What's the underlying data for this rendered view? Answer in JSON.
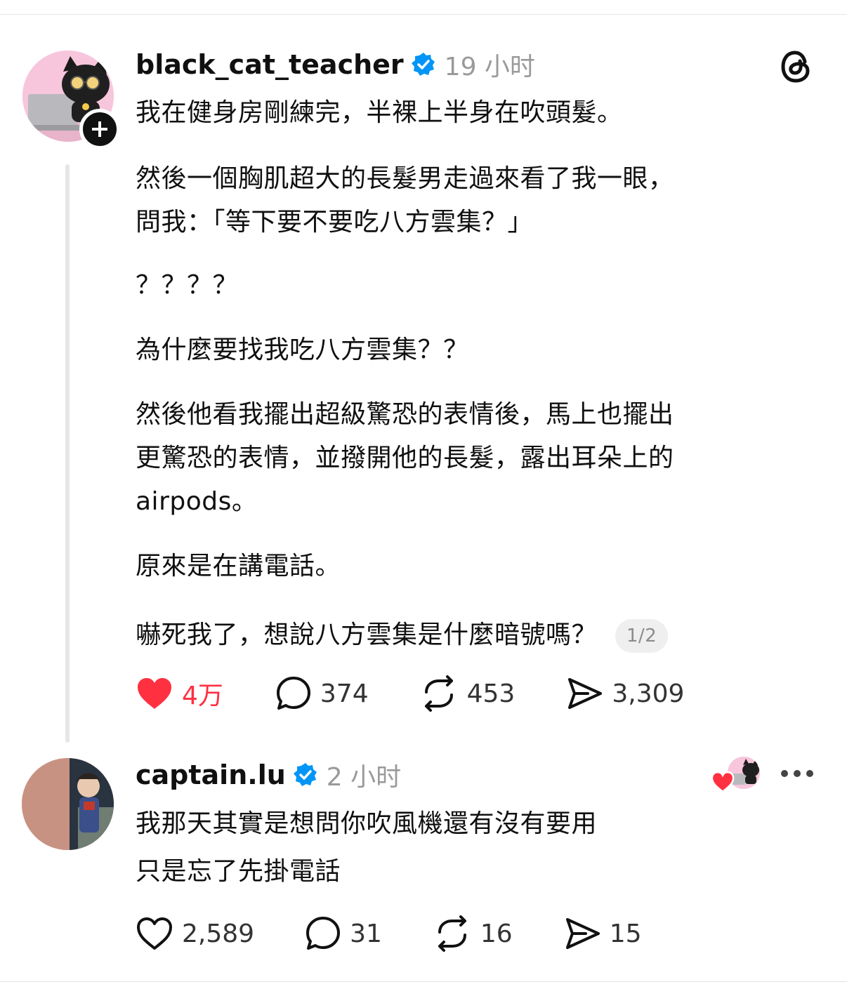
{
  "post": {
    "username": "black_cat_teacher",
    "time": "19 小时",
    "paragraphs": [
      "我在健身房剛練完，半裸上半身在吹頭髮。",
      "然後一個胸肌超大的長髮男走過來看了我一眼，\n問我：「等下要不要吃八方雲集？」",
      "？？？？",
      "為什麼要找我吃八方雲集？？",
      "然後他看我擺出超級驚恐的表情後，馬上也擺出\n更驚恐的表情，並撥開他的長髮，露出耳朵上的\nairpods。",
      "原來是在講電話。"
    ],
    "last_line": "嚇死我了，想說八方雲集是什麼暗號嗎？",
    "page_indicator": "1/2",
    "likes": "4万",
    "replies": "374",
    "reposts": "453",
    "shares": "3,309"
  },
  "reply": {
    "username": "captain.lu",
    "time": "2 小时",
    "text": "我那天其實是想問你吹風機還有沒有要用\n只是忘了先掛電話",
    "likes": "2,589",
    "replies": "31",
    "reposts": "16",
    "shares": "15"
  },
  "colors": {
    "liked": "#ff3040",
    "verified": "#0095f6",
    "muted": "#9a9a9a"
  }
}
